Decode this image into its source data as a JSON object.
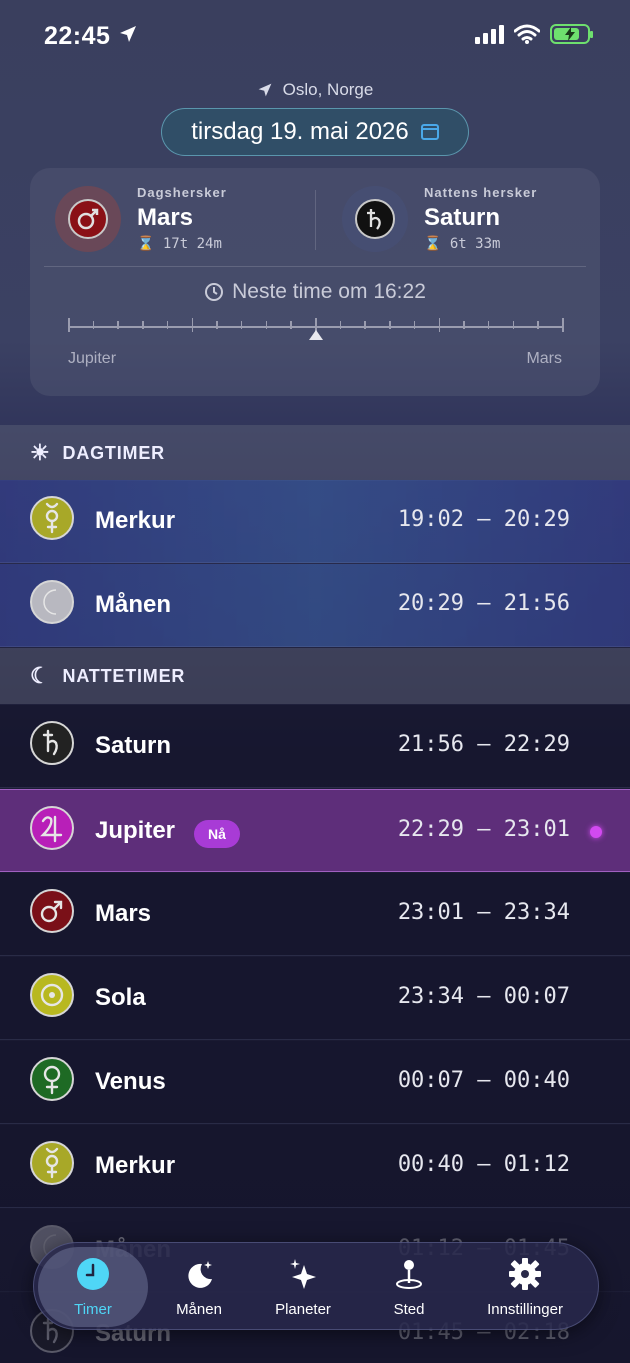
{
  "status": {
    "time": "22:45"
  },
  "header": {
    "location": "Oslo, Norge",
    "date": "tirsdag 19. mai 2026"
  },
  "card": {
    "day_ruler": {
      "label": "Dagshersker",
      "name": "Mars",
      "duration": "17t 24m"
    },
    "night_ruler": {
      "label": "Nattens hersker",
      "name": "Saturn",
      "duration": "6t 33m"
    },
    "next_hour": "Neste time om 16:22",
    "timeline_from": "Jupiter",
    "timeline_to": "Mars",
    "timeline_progress": 0.5
  },
  "sections": {
    "day": "DAGTIMER",
    "night": "NATTETIMER"
  },
  "day_hours": [
    {
      "planet": "Merkur",
      "range": "19:02 – 20:29",
      "icon": "mercury-icon",
      "color": "#a8a828"
    },
    {
      "planet": "Månen",
      "range": "20:29 – 21:56",
      "icon": "moon-icon",
      "color": "#b8b8c0"
    }
  ],
  "night_hours": [
    {
      "planet": "Saturn",
      "range": "21:56 – 22:29",
      "icon": "saturn-icon",
      "color": "#222"
    },
    {
      "planet": "Jupiter",
      "range": "22:29 – 23:01",
      "icon": "jupiter-icon",
      "color": "#b81fb8",
      "current": true,
      "badge": "Nå"
    },
    {
      "planet": "Mars",
      "range": "23:01 – 23:34",
      "icon": "mars-icon",
      "color": "#7a1018"
    },
    {
      "planet": "Sola",
      "range": "23:34 – 00:07",
      "icon": "sun-planet-icon",
      "color": "#b8b820"
    },
    {
      "planet": "Venus",
      "range": "00:07 – 00:40",
      "icon": "venus-icon",
      "color": "#1e6a24"
    },
    {
      "planet": "Merkur",
      "range": "00:40 – 01:12",
      "icon": "mercury-icon",
      "color": "#a8a828"
    },
    {
      "planet": "Månen",
      "range": "01:12 – 01:45",
      "icon": "moon-icon",
      "color": "#b8b8c0"
    },
    {
      "planet": "Saturn",
      "range": "01:45 – 02:18",
      "icon": "saturn-icon",
      "color": "#222"
    }
  ],
  "tabs": [
    {
      "label": "Timer",
      "icon": "clock-icon",
      "active": true
    },
    {
      "label": "Månen",
      "icon": "moon-stars-icon"
    },
    {
      "label": "Planeter",
      "icon": "sparkles-icon"
    },
    {
      "label": "Sted",
      "icon": "location-pin-icon"
    },
    {
      "label": "Innstillinger",
      "icon": "gear-icon"
    }
  ],
  "colors": {
    "accent": "#4fd6f6",
    "current_row": "#5e2e7a",
    "now_badge": "#a83bd6"
  }
}
